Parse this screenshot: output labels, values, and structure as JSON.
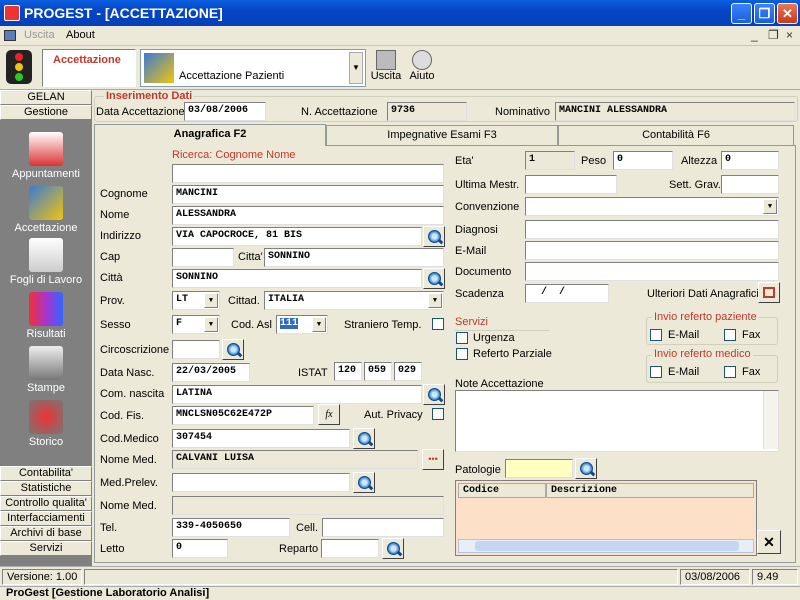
{
  "window": {
    "title": "PROGEST - [ACCETTAZIONE]",
    "minimize": "_",
    "maximize": "❐",
    "close": "✕"
  },
  "menu": {
    "uscita": "Uscita",
    "about": "About"
  },
  "toolbar": {
    "section": "Accettazione",
    "module": "Accettazione Pazienti",
    "uscita": "Uscita",
    "aiuto": "Aiuto"
  },
  "nav": {
    "gelan": "GELAN",
    "gestione": "Gestione",
    "items": [
      "Appuntamenti",
      "Accettazione",
      "Fogli di Lavoro",
      "Risultati",
      "Stampe",
      "Storico"
    ],
    "bottom": [
      "Contabilita'",
      "Statistiche",
      "Controllo qualita'",
      "Interfacciamenti",
      "Archivi di base",
      "Servizi"
    ]
  },
  "header": {
    "group": "Inserimento Dati",
    "data_label": "Data Accettazione",
    "data_value": "03/08/2006",
    "num_label": "N. Accettazione",
    "num_value": "9736",
    "nom_label": "Nominativo",
    "nom_value": "MANCINI ALESSANDRA"
  },
  "tabs": [
    "Anagrafica F2",
    "Impegnative Esami F3",
    "Contabilità F6"
  ],
  "left": {
    "ricerca": "Ricerca: Cognome Nome",
    "cognome_l": "Cognome",
    "cognome": "MANCINI",
    "nome_l": "Nome",
    "nome": "ALESSANDRA",
    "indirizzo_l": "Indirizzo",
    "indirizzo": "VIA CAPOCROCE, 81 BIS",
    "cap_l": "Cap",
    "citta2_l": "Citta'",
    "citta2": "SONNINO",
    "citta_l": "Città",
    "citta": "SONNINO",
    "prov_l": "Prov.",
    "prov": "LT",
    "cittad_l": "Cittad.",
    "cittad": "ITALIA",
    "sesso_l": "Sesso",
    "sesso": "F",
    "codasl_l": "Cod. Asl",
    "codasl": "111",
    "straniero_l": "Straniero Temp.",
    "circ_l": "Circoscrizione",
    "nasc_l": "Data Nasc.",
    "nasc": "22/03/2005",
    "istat_l": "ISTAT",
    "istat": [
      "120",
      "059",
      "029"
    ],
    "comnasc_l": "Com. nascita",
    "comnasc": "LATINA",
    "codfis_l": "Cod. Fis.",
    "codfis": "MNCLSN05C62E472P",
    "fx": "fx",
    "privacy_l": "Aut. Privacy",
    "codmed_l": "Cod.Medico",
    "codmed": "307454",
    "nomemed_l": "Nome Med.",
    "nomemed": "CALVANI LUISA",
    "dots": "•••",
    "medprel_l": "Med.Prelev.",
    "nomemed2_l": "Nome Med.",
    "tel_l": "Tel.",
    "tel": "339-4050650",
    "cell_l": "Cell.",
    "letto_l": "Letto",
    "letto": "0",
    "reparto_l": "Reparto"
  },
  "right": {
    "eta_l": "Eta'",
    "eta": "1",
    "peso_l": "Peso",
    "peso": "0",
    "altezza_l": "Altezza",
    "altezza": "0",
    "mestr_l": "Ultima Mestr.",
    "sett_l": "Sett. Grav.",
    "conv_l": "Convenzione",
    "diagnosi_l": "Diagnosi",
    "email_l": "E-Mail",
    "documento_l": "Documento",
    "scadenza_l": "Scadenza",
    "scadenza": "  /  /",
    "ulteriori": "Ulteriori Dati Anagrafici",
    "servizi": "Servizi",
    "urgenza": "Urgenza",
    "referto": "Referto Parziale",
    "invio_paz": "Invio referto paziente",
    "invio_med": "Invio referto medico",
    "email": "E-Mail",
    "fax": "Fax",
    "note_l": "Note Accettazione",
    "patologie_l": "Patologie",
    "grid_cols": [
      "Codice",
      "Descrizione"
    ],
    "close_btn": "✕"
  },
  "status": {
    "version": "Versione: 1.00",
    "date": "03/08/2006",
    "time": "9.49"
  },
  "taskbar": "ProGest [Gestione Laboratorio Analisi]",
  "colors": {
    "titlebar": "#0a5fe0",
    "label_red": "#c0392b",
    "grid_bg": "#fde0c8"
  }
}
